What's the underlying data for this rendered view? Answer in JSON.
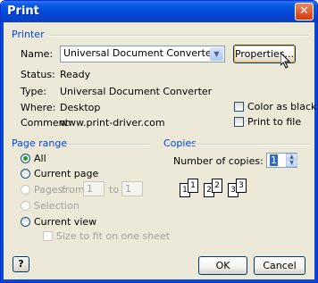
{
  "window": {
    "title": "Print",
    "close_glyph": "✕"
  },
  "printer": {
    "section_label": "Printer",
    "name_label": "Name:",
    "name_value": "Universal Document Converter",
    "properties_button": "Properties...",
    "status_label": "Status:",
    "status_value": "Ready",
    "type_label": "Type:",
    "type_value": "Universal Document Converter",
    "where_label": "Where:",
    "where_value": "Desktop",
    "comment_label": "Comment:",
    "comment_value": "www.print-driver.com",
    "color_as_black": {
      "label": "Color as black",
      "checked": false
    },
    "print_to_file": {
      "label": "Print to file",
      "checked": false
    }
  },
  "page_range": {
    "section_label": "Page range",
    "all": "All",
    "current_page": "Current page",
    "pages": "Pages:",
    "from_label": "from",
    "from_value": "1",
    "to_label": "to",
    "to_value": "1",
    "selection": "Selection",
    "current_view": "Current view",
    "size_to_fit": "Size to fit on one sheet",
    "selected": "All"
  },
  "copies": {
    "section_label": "Copies",
    "number_label": "Number of copies:",
    "number_value": "1",
    "collate_pages": [
      "1",
      "1",
      "2",
      "2",
      "3",
      "3"
    ]
  },
  "footer": {
    "help_glyph": "?",
    "ok": "OK",
    "cancel": "Cancel"
  },
  "colors": {
    "title_bar": "#0a5ae6",
    "section_label": "#0046d5",
    "dialog_bg": "#ece9d8"
  },
  "icons": [
    "close-icon",
    "dropdown-arrow-icon",
    "help-icon",
    "mouse-pointer-icon",
    "collate-icon"
  ]
}
